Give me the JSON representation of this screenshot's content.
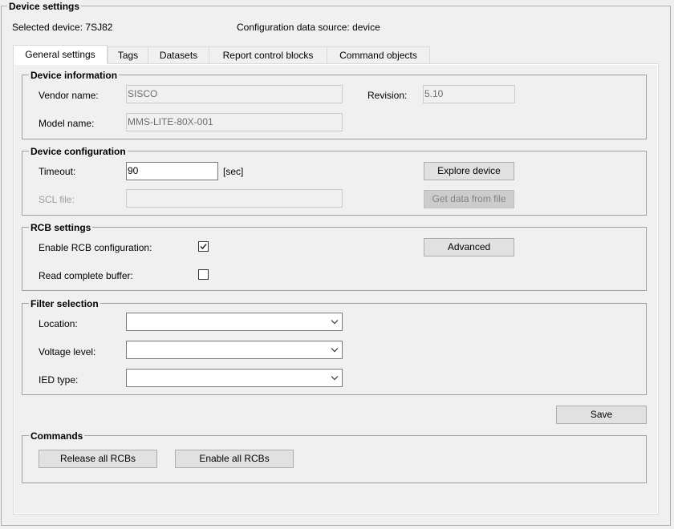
{
  "window": {
    "title": "Device settings",
    "selected_device_label": "Selected device: 7SJ82",
    "config_source_label": "Configuration data source: device"
  },
  "tabs": [
    {
      "label": "General settings",
      "active": true
    },
    {
      "label": "Tags",
      "active": false
    },
    {
      "label": "Datasets",
      "active": false
    },
    {
      "label": "Report control blocks",
      "active": false
    },
    {
      "label": "Command objects",
      "active": false
    }
  ],
  "device_information": {
    "title": "Device information",
    "vendor_label": "Vendor name:",
    "vendor_value": "SISCO",
    "revision_label": "Revision:",
    "revision_value": "5.10",
    "model_label": "Model name:",
    "model_value": "MMS-LITE-80X-001"
  },
  "device_configuration": {
    "title": "Device configuration",
    "timeout_label": "Timeout:",
    "timeout_value": "90",
    "timeout_unit": "[sec]",
    "explore_button": "Explore device",
    "scl_label": "SCL file:",
    "scl_value": "",
    "get_data_button": "Get data from file"
  },
  "rcb_settings": {
    "title": "RCB settings",
    "enable_label": "Enable RCB configuration:",
    "enable_checked": true,
    "read_buffer_label": "Read complete buffer:",
    "read_buffer_checked": false,
    "advanced_button": "Advanced"
  },
  "filter_selection": {
    "title": "Filter selection",
    "location_label": "Location:",
    "location_value": "",
    "voltage_label": "Voltage level:",
    "voltage_value": "",
    "ied_label": "IED type:",
    "ied_value": ""
  },
  "save_button": "Save",
  "commands": {
    "title": "Commands",
    "release_button": "Release all RCBs",
    "enable_button": "Enable all RCBs"
  },
  "icons": {
    "checkbox_checked": "check-icon",
    "dropdown": "chevron-down-icon"
  }
}
